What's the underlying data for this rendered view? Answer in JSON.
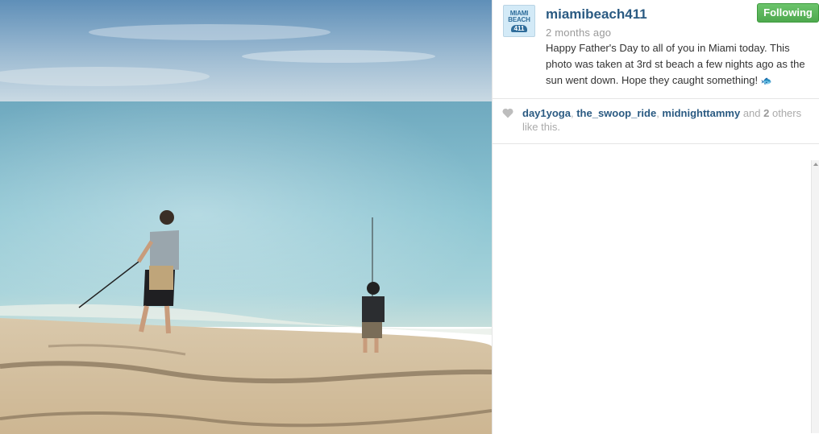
{
  "post": {
    "username": "miamibeach411",
    "timestamp": "2 months ago",
    "follow_label": "Following",
    "caption": "Happy Father's Day to all of you in Miami today. This photo was taken at 3rd st beach a few nights ago as the sun went down. Hope they caught something!",
    "caption_emoji": "fish-icon",
    "avatar": {
      "line1": "MIAMI",
      "line2": "BEACH",
      "line3": "411"
    }
  },
  "likes": {
    "users": [
      "day1yoga",
      "the_swoop_ride",
      "midnighttammy"
    ],
    "separator": ", ",
    "and_word": " and ",
    "others_count": "2",
    "others_suffix": " others like this."
  },
  "colors": {
    "link": "#2a5a82",
    "follow_green": "#5cb85c",
    "muted": "#999999"
  }
}
